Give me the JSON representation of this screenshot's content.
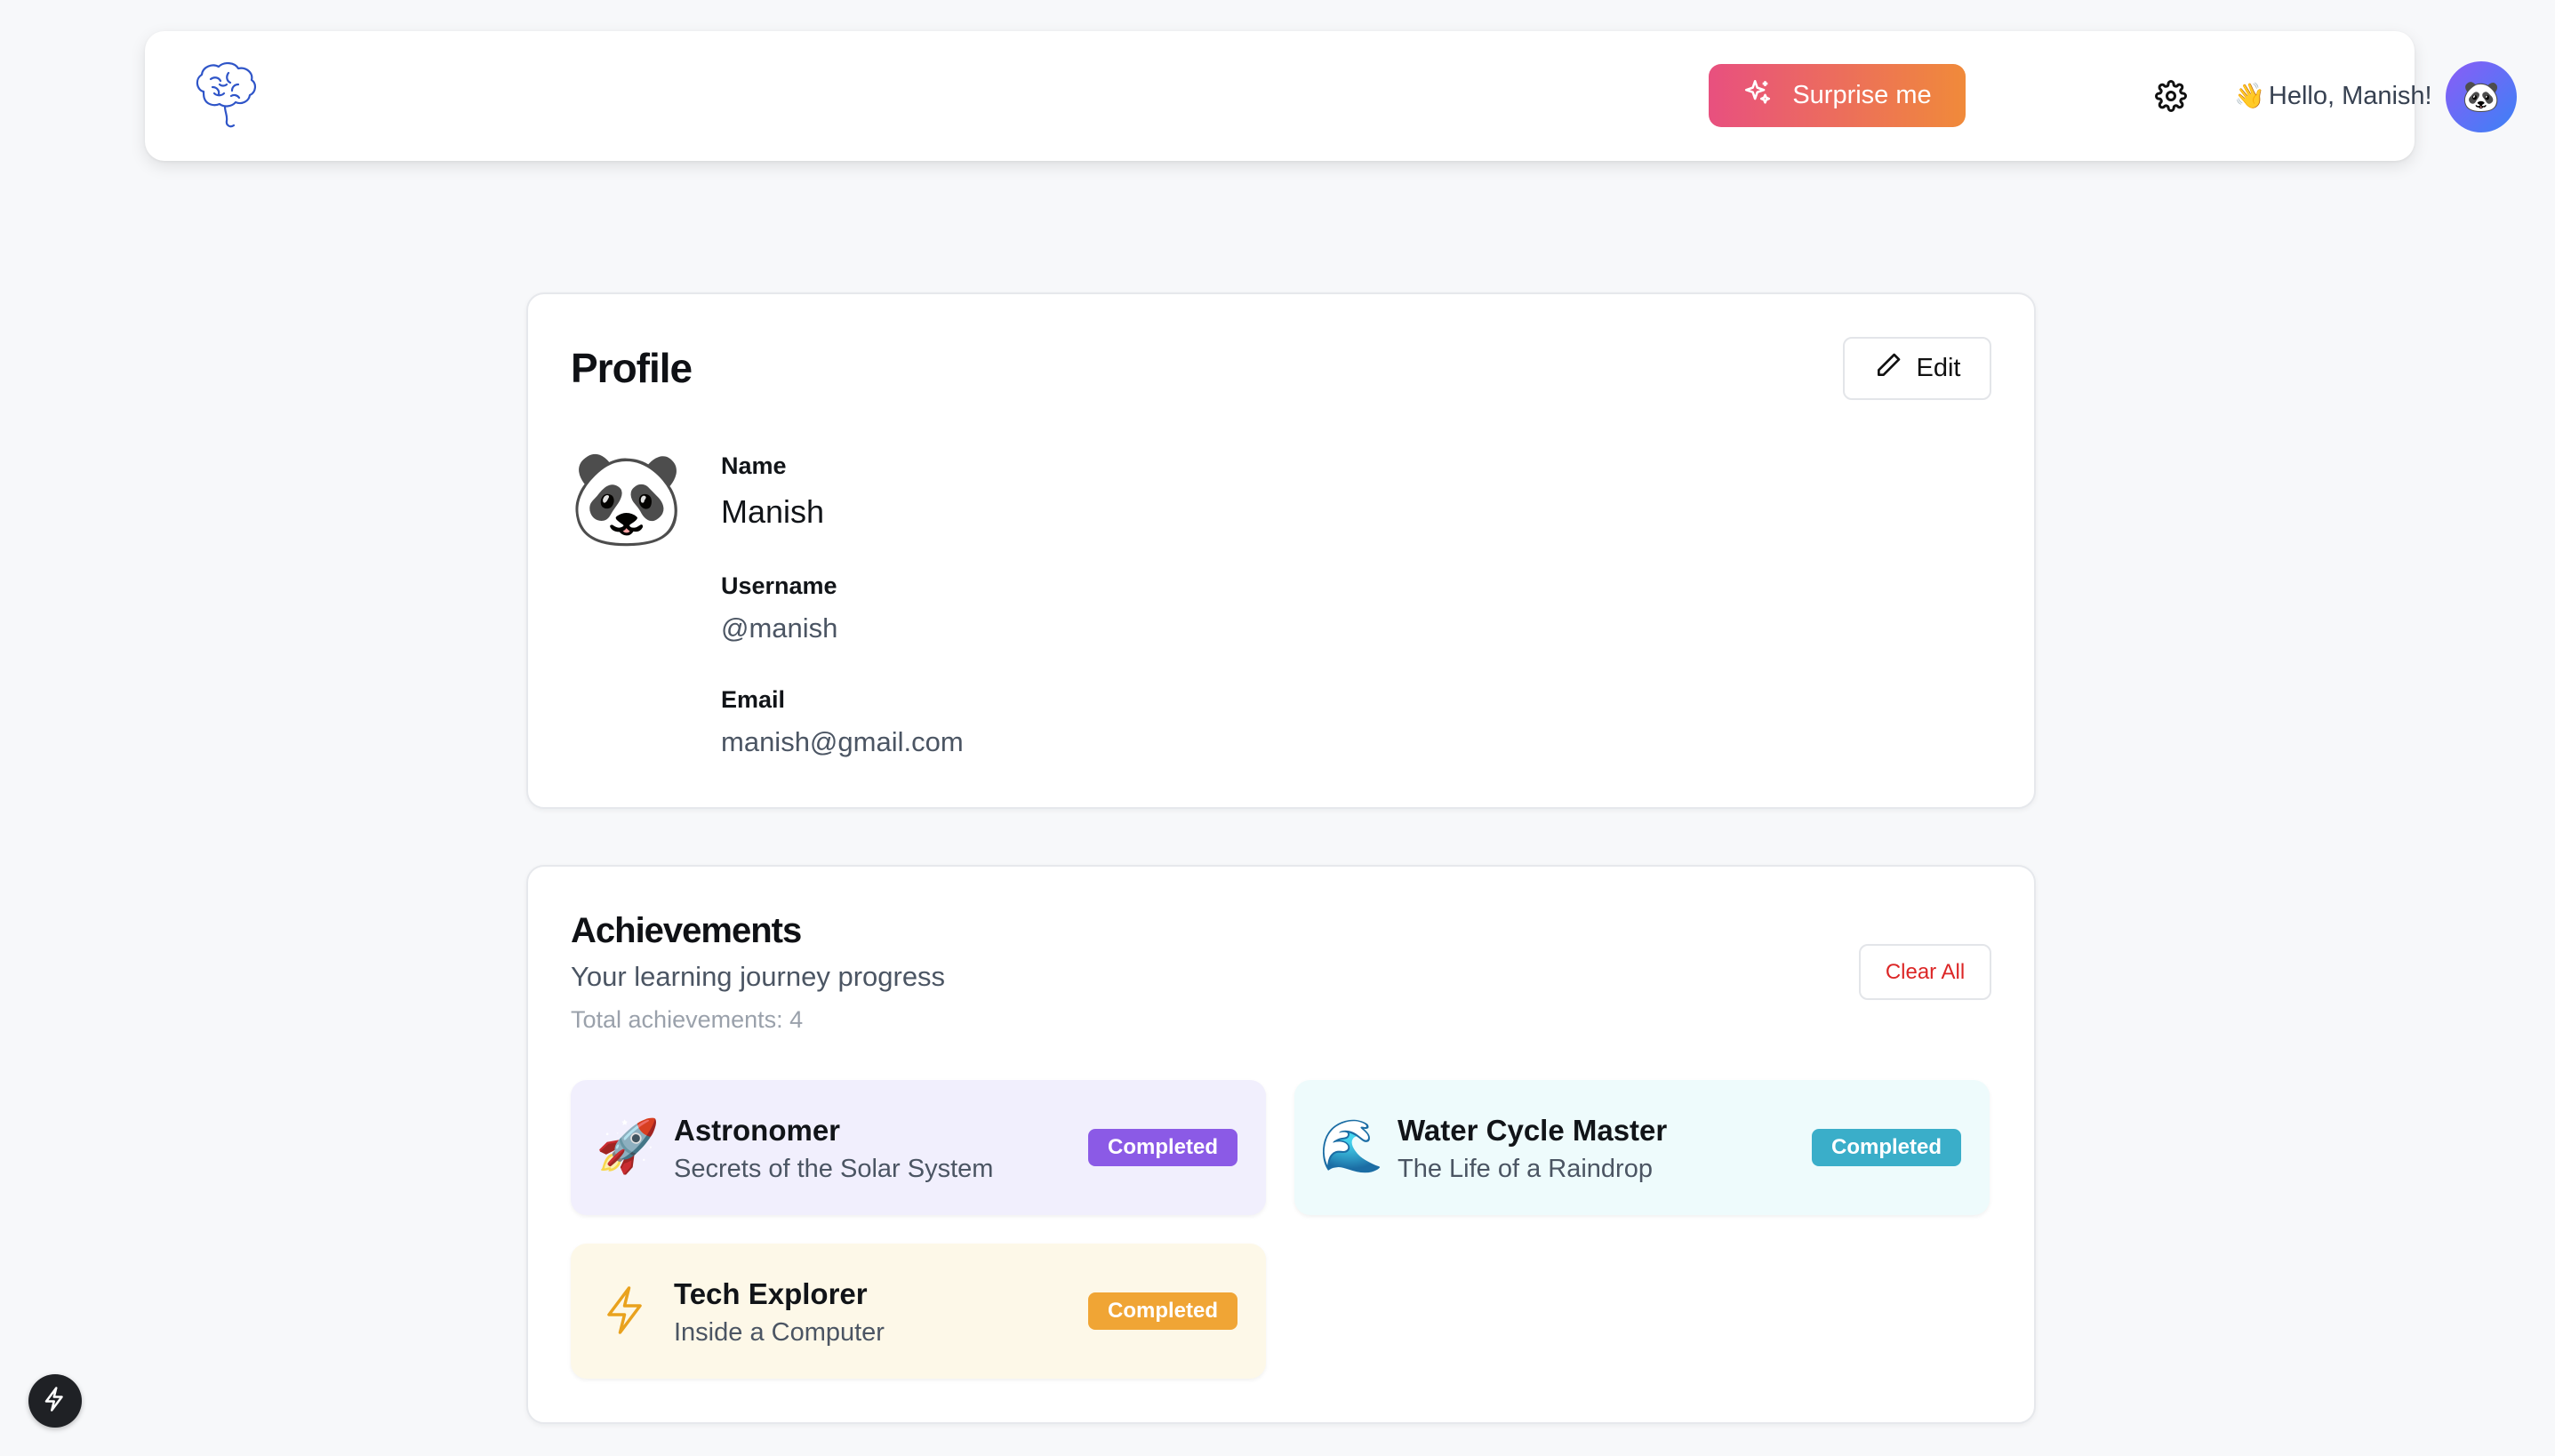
{
  "header": {
    "logo_icon": "brain-icon",
    "surprise_label": "Surprise me",
    "surprise_icon": "sparkles-icon",
    "settings_icon": "gear-icon",
    "wave_emoji": "👋",
    "greeting": "Hello, Manish!",
    "avatar_emoji": "🐼",
    "brand_gradient": [
      "#e8507f",
      "#f08a3a"
    ]
  },
  "profile": {
    "title": "Profile",
    "edit_label": "Edit",
    "avatar_emoji": "🐼",
    "name_label": "Name",
    "name_value": "Manish",
    "username_label": "Username",
    "username_value": "@manish",
    "email_label": "Email",
    "email_value": "manish@gmail.com"
  },
  "achievements": {
    "title": "Achievements",
    "subtitle": "Your learning journey progress",
    "total": "Total achievements: 4",
    "clear_label": "Clear All",
    "items": [
      {
        "emoji": "🚀",
        "name": "Astronomer",
        "desc": "Secrets of the Solar System",
        "status": "Completed",
        "color": "#8b5ae6"
      },
      {
        "emoji": "🌊",
        "name": "Water Cycle Master",
        "desc": "The Life of a Raindrop",
        "status": "Completed",
        "color": "#3aaec9"
      },
      {
        "emoji": "⚡",
        "name": "Tech Explorer",
        "desc": "Inside a Computer",
        "status": "Completed",
        "color": "#f0a535"
      }
    ]
  },
  "fab_icon": "lightning-icon"
}
